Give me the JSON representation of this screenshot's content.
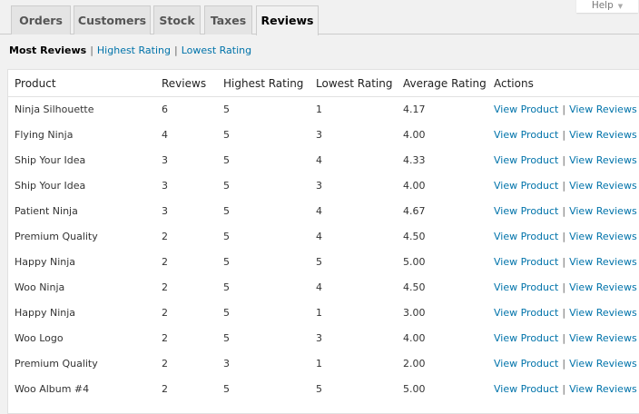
{
  "help": {
    "label": "Help",
    "icon": "triangle-down-icon"
  },
  "tabs": [
    {
      "label": "Orders"
    },
    {
      "label": "Customers"
    },
    {
      "label": "Stock"
    },
    {
      "label": "Taxes"
    },
    {
      "label": "Reviews",
      "active": true
    }
  ],
  "subnav": {
    "current": "Most Reviews",
    "links": [
      "Highest Rating",
      "Lowest Rating"
    ]
  },
  "table": {
    "headers": [
      "Product",
      "Reviews",
      "Highest Rating",
      "Lowest Rating",
      "Average Rating",
      "Actions"
    ],
    "action_labels": {
      "view_product": "View Product",
      "view_reviews": "View Reviews",
      "sep": "|"
    },
    "rows": [
      [
        "Ninja Silhouette",
        "6",
        "5",
        "1",
        "4.17"
      ],
      [
        "Flying Ninja",
        "4",
        "5",
        "3",
        "4.00"
      ],
      [
        "Ship Your Idea",
        "3",
        "5",
        "4",
        "4.33"
      ],
      [
        "Ship Your Idea",
        "3",
        "5",
        "3",
        "4.00"
      ],
      [
        "Patient Ninja",
        "3",
        "5",
        "4",
        "4.67"
      ],
      [
        "Premium Quality",
        "2",
        "5",
        "4",
        "4.50"
      ],
      [
        "Happy Ninja",
        "2",
        "5",
        "5",
        "5.00"
      ],
      [
        "Woo Ninja",
        "2",
        "5",
        "4",
        "4.50"
      ],
      [
        "Happy Ninja",
        "2",
        "5",
        "1",
        "3.00"
      ],
      [
        "Woo Logo",
        "2",
        "5",
        "3",
        "4.00"
      ],
      [
        "Premium Quality",
        "2",
        "3",
        "1",
        "2.00"
      ],
      [
        "Woo Album #4",
        "2",
        "5",
        "5",
        "5.00"
      ]
    ]
  }
}
